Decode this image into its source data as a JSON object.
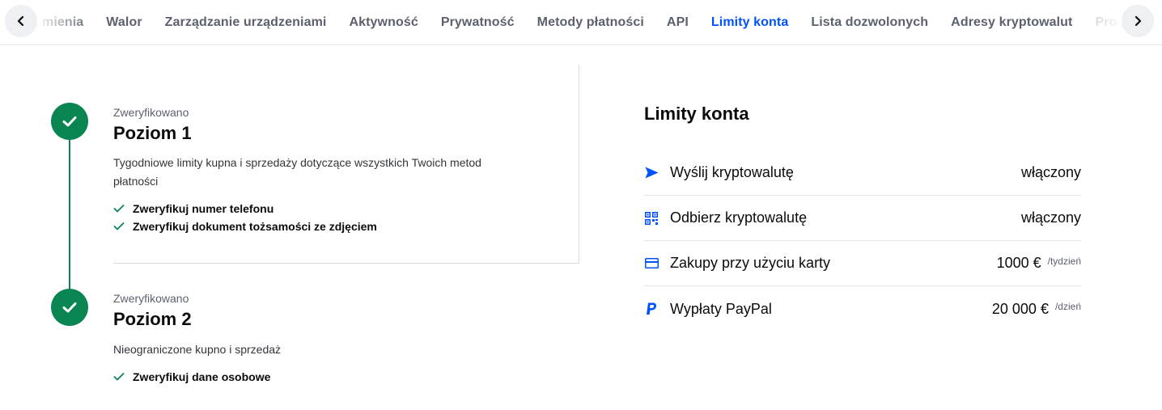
{
  "tabbar": {
    "tabs": [
      {
        "label": "mienia",
        "active": false
      },
      {
        "label": "Walor",
        "active": false
      },
      {
        "label": "Zarządzanie urządzeniami",
        "active": false
      },
      {
        "label": "Aktywność",
        "active": false
      },
      {
        "label": "Prywatność",
        "active": false
      },
      {
        "label": "Metody płatności",
        "active": false
      },
      {
        "label": "API",
        "active": false
      },
      {
        "label": "Limity konta",
        "active": true
      },
      {
        "label": "Lista dozwolonych",
        "active": false
      },
      {
        "label": "Adresy kryptowalut",
        "active": false
      },
      {
        "label": "Pro",
        "active": false
      }
    ],
    "scroll_left_icon": "chevron-left-icon",
    "scroll_right_icon": "chevron-right-icon"
  },
  "levels": [
    {
      "status": "Zweryfikowano",
      "title": "Poziom 1",
      "description": "Tygodniowe limity kupna i sprzedaży dotyczące wszystkich Twoich metod płatności",
      "requirements": [
        "Zweryfikuj numer telefonu",
        "Zweryfikuj dokument tożsamości ze zdjęciem"
      ]
    },
    {
      "status": "Zweryfikowano",
      "title": "Poziom 2",
      "description": "Nieograniczone kupno i sprzedaż",
      "requirements": [
        "Zweryfikuj dane osobowe"
      ]
    }
  ],
  "limits": {
    "title": "Limity konta",
    "rows": [
      {
        "icon": "send-arrow-icon",
        "label": "Wyślij kryptowalutę",
        "value": "włączony",
        "unit": ""
      },
      {
        "icon": "qr-code-icon",
        "label": "Odbierz kryptowalutę",
        "value": "włączony",
        "unit": ""
      },
      {
        "icon": "credit-card-icon",
        "label": "Zakupy przy użyciu karty",
        "value": "1000 €",
        "unit": "/tydzień"
      },
      {
        "icon": "paypal-icon",
        "label": "Wypłaty PayPal",
        "value": "20 000 €",
        "unit": "/dzień"
      }
    ]
  },
  "colors": {
    "accent": "#0052ff",
    "verified": "#098551",
    "muted": "#5b616e"
  }
}
